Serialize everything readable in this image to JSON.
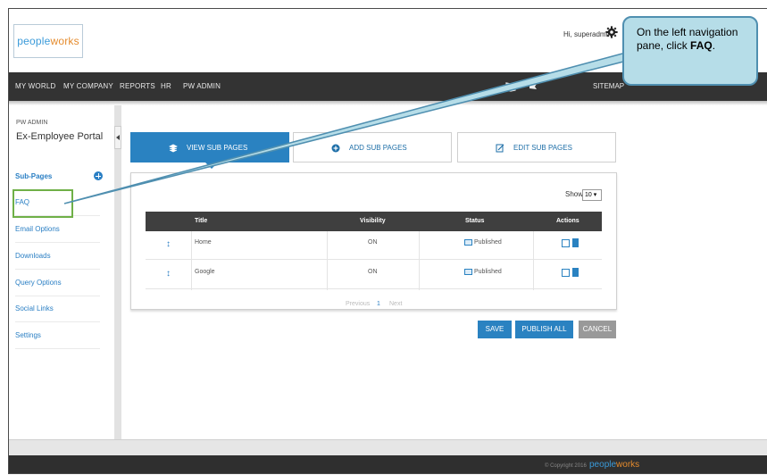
{
  "logo": {
    "part1": "peo",
    "part2": "ple",
    "part3": "works"
  },
  "header": {
    "greeting": "Hi, superadmin"
  },
  "nav": {
    "items": [
      "MY WORLD",
      "MY COMPANY",
      "REPORTS",
      "HR",
      "PW ADMIN"
    ],
    "sitemap": "SITEMAP"
  },
  "sidebar": {
    "section": "PW ADMIN",
    "portal": "Ex-Employee Portal",
    "subpages": "Sub-Pages",
    "items": [
      "FAQ",
      "Email Options",
      "Downloads",
      "Query Options",
      "Social Links",
      "Settings"
    ]
  },
  "tabs": [
    "VIEW SUB PAGES",
    "ADD SUB PAGES",
    "EDIT SUB PAGES"
  ],
  "table": {
    "show_label": "Show",
    "show_value": "10",
    "headers": [
      "Title",
      "Visibility",
      "Status",
      "Actions"
    ],
    "rows": [
      {
        "title": "Home",
        "visibility": "ON",
        "status": "Published"
      },
      {
        "title": "Google",
        "visibility": "ON",
        "status": "Published"
      }
    ],
    "pager": {
      "prev": "Previous",
      "page": "1",
      "next": "Next"
    }
  },
  "buttons": {
    "save": "SAVE",
    "publish": "PUBLISH ALL",
    "cancel": "CANCEL"
  },
  "footer": {
    "copyright": "© Copyright 2016"
  },
  "callout": {
    "line1": "On the left navigation pane, click ",
    "bold": "FAQ",
    "end": "."
  },
  "colors": {
    "accent": "#2a82c1",
    "nav_bg": "#333333",
    "callout_bg": "#b6dde8",
    "highlight": "#6fb047"
  }
}
